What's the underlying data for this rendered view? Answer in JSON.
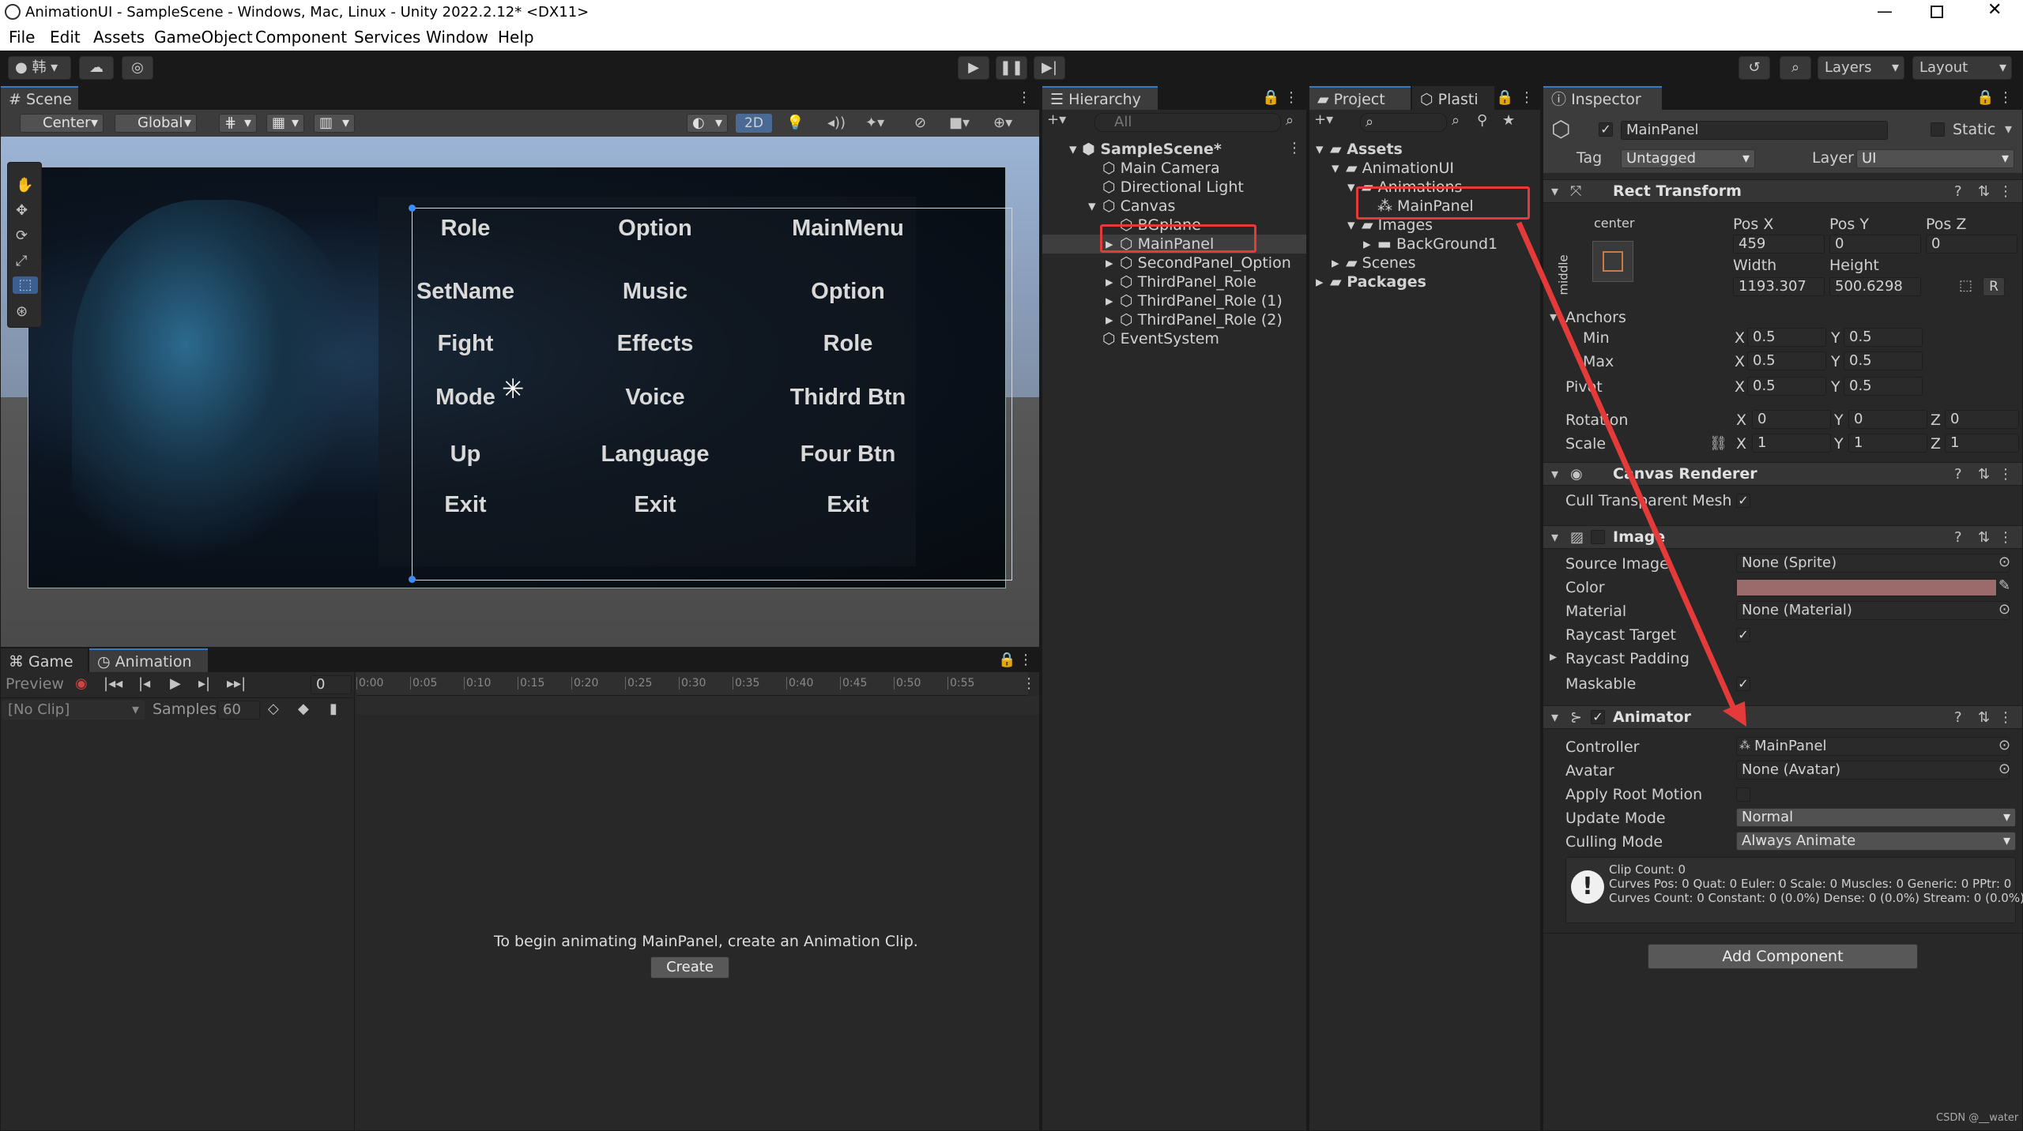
{
  "window": {
    "title": "AnimationUI - SampleScene - Windows, Mac, Linux - Unity 2022.2.12* <DX11>"
  },
  "menu": [
    "File",
    "Edit",
    "Assets",
    "GameObject",
    "Component",
    "Services",
    "Window",
    "Help"
  ],
  "toolbar": {
    "account": "韩",
    "layers": "Layers",
    "layout": "Layout"
  },
  "scene": {
    "tab": "Scene",
    "pivot": "Center",
    "space": "Global",
    "mode2d": "2D",
    "grid": [
      [
        "Role",
        "Option",
        "MainMenu"
      ],
      [
        "SetName",
        "Music",
        "Option"
      ],
      [
        "Fight",
        "Effects",
        "Role"
      ],
      [
        "Mode",
        "Voice",
        "Thidrd Btn"
      ],
      [
        "Up",
        "Language",
        "Four Btn"
      ],
      [
        "Exit",
        "Exit",
        "Exit"
      ]
    ]
  },
  "bottom": {
    "tabs": [
      "Game",
      "Animation"
    ],
    "preview": "Preview",
    "frame": "0",
    "timeline": [
      "0:00",
      "0:05",
      "0:10",
      "0:15",
      "0:20",
      "0:25",
      "0:30",
      "0:35",
      "0:40",
      "0:45",
      "0:50",
      "0:55"
    ],
    "clip": "[No Clip]",
    "samples_label": "Samples",
    "samples": "60",
    "message": "To begin animating MainPanel, create an Animation Clip.",
    "create": "Create"
  },
  "hierarchy": {
    "tab": "Hierarchy",
    "search_placeholder": "All",
    "scene": "SampleScene*",
    "items": [
      "Main Camera",
      "Directional Light",
      "Canvas",
      "BGplane",
      "MainPanel",
      "SecondPanel_Option",
      "ThirdPanel_Role",
      "ThirdPanel_Role (1)",
      "ThirdPanel_Role (2)",
      "EventSystem"
    ]
  },
  "project": {
    "tab": "Project",
    "tab2": "Plasti",
    "items": [
      "Assets",
      "AnimationUI",
      "Animations",
      "MainPanel",
      "Images",
      "BackGround1",
      "Scenes",
      "Packages"
    ]
  },
  "inspector": {
    "tab": "Inspector",
    "name": "MainPanel",
    "static": "Static",
    "tag_label": "Tag",
    "tag": "Untagged",
    "layer_label": "Layer",
    "layer": "UI",
    "rect": {
      "title": "Rect Transform",
      "anchor_h": "center",
      "anchor_v": "middle",
      "posx_l": "Pos X",
      "posy_l": "Pos Y",
      "posz_l": "Pos Z",
      "posx": "459",
      "posy": "0",
      "posz": "0",
      "width_l": "Width",
      "height_l": "Height",
      "width": "1193.307",
      "height": "500.6298",
      "r_btn": "R",
      "anchors": "Anchors",
      "min": "Min",
      "max": "Max",
      "pivot": "Pivot",
      "rotation": "Rotation",
      "scale": "Scale",
      "x": "X",
      "y": "Y",
      "z": "Z",
      "min_x": "0.5",
      "min_y": "0.5",
      "max_x": "0.5",
      "max_y": "0.5",
      "pivot_x": "0.5",
      "pivot_y": "0.5",
      "rot_x": "0",
      "rot_y": "0",
      "rot_z": "0",
      "scale_x": "1",
      "scale_y": "1",
      "scale_z": "1"
    },
    "canvas_renderer": {
      "title": "Canvas Renderer",
      "cull": "Cull Transparent Mesh"
    },
    "image": {
      "title": "Image",
      "source_l": "Source Image",
      "source": "None (Sprite)",
      "color_l": "Color",
      "color": "#9b6b6b",
      "material_l": "Material",
      "material": "None (Material)",
      "raycast_l": "Raycast Target",
      "padding_l": "Raycast Padding",
      "maskable_l": "Maskable"
    },
    "animator": {
      "title": "Animator",
      "controller_l": "Controller",
      "controller": "MainPanel",
      "avatar_l": "Avatar",
      "avatar": "None (Avatar)",
      "root_l": "Apply Root Motion",
      "update_l": "Update Mode",
      "update": "Normal",
      "culling_l": "Culling Mode",
      "culling": "Always Animate",
      "info1": "Clip Count: 0",
      "info2": "Curves Pos: 0 Quat: 0 Euler: 0 Scale: 0 Muscles: 0 Generic: 0 PPtr: 0",
      "info3": "Curves Count: 0 Constant: 0 (0.0%) Dense: 0 (0.0%) Stream: 0 (0.0%)"
    },
    "add_component": "Add Component"
  },
  "watermark": "CSDN @__water",
  "colors": {
    "accent": "#3a79bb",
    "highlight": "#e53a3a"
  }
}
